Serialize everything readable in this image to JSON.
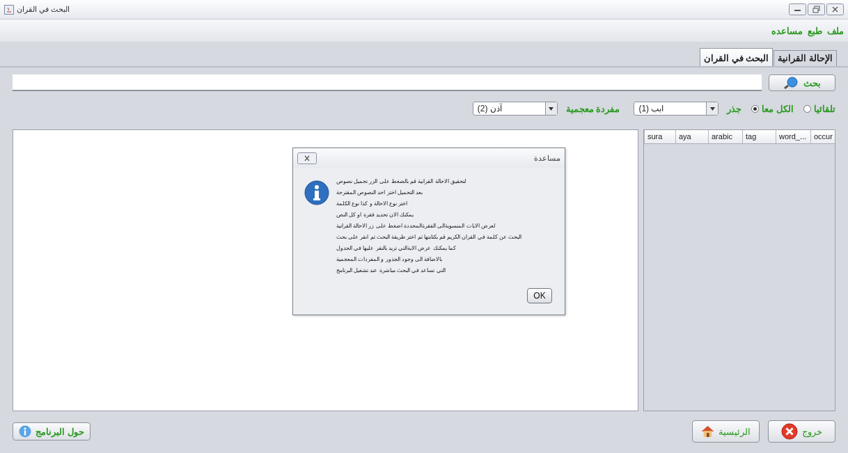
{
  "window": {
    "title": "البحث في القران"
  },
  "menu": [
    {
      "label": "ملف"
    },
    {
      "label": "طبع"
    },
    {
      "label": "مساعده"
    }
  ],
  "tabs": [
    {
      "label": "الإحالة القرانية",
      "selected": false
    },
    {
      "label": "البحث في القران",
      "selected": true
    }
  ],
  "search": {
    "button": "بحث"
  },
  "modes": [
    {
      "label": "تلقائيا",
      "selected": false
    },
    {
      "label": "الكل معا",
      "selected": true
    }
  ],
  "filters": [
    {
      "label": "جذر",
      "value": "ابب (1)"
    },
    {
      "label": "مفردة معجمية",
      "value": "آذن (2)"
    }
  ],
  "table": {
    "columns": [
      "occur",
      "word_...",
      "tag",
      "arabic",
      "aya",
      "sura"
    ]
  },
  "dialog": {
    "title": "مساعدة",
    "lines": [
      "لتحقيق الاحالة القرانية قم بالضغط على الزر تحميل نصوص",
      "بعد التحميل اختر احد النصوص المقترحة",
      "اختر نوع الاحالة و كذا نوع الكلمة",
      "يمكنك الان تحديد فقرة او كل النص",
      "لعرض الايات المنسوبةالى الفقرةالمحددة اضغط على زر الاحالة القرانية",
      "البحث عن كلمة في القران الكريم قم بكتابتها ثم اختر طريقة البحث ثم انقر على بحث",
      "كما يمكنك عرض الايةالتي تريد بالنقر عليها في الجدول",
      "بالاضافة الى وجود الجذور و المفردات المعجمية",
      "التي تساعد في البحث مباشرة عند تشغيل البرنامج"
    ],
    "button": "OK"
  },
  "buttons": [
    {
      "label": "خروج",
      "kind": "exit"
    },
    {
      "label": "الرئيسية",
      "kind": "home"
    },
    {
      "label": "حول البرنامج",
      "kind": "about"
    }
  ]
}
